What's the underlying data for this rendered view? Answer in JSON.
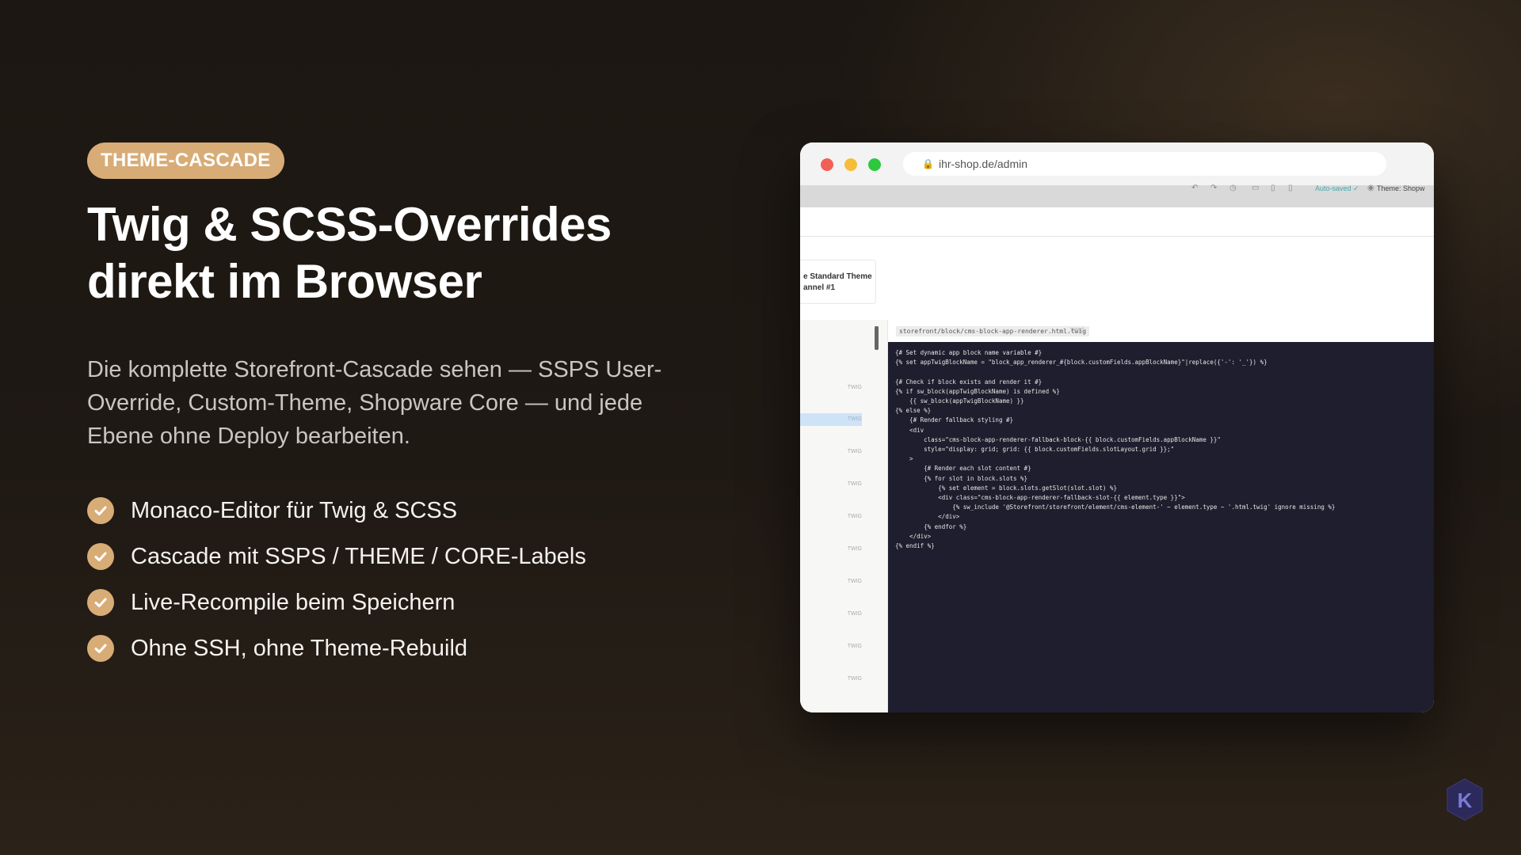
{
  "slide": {
    "badge": "THEME-CASCADE",
    "title_line1": "Twig & SCSS-Overrides",
    "title_line2": "direkt im Browser",
    "description": "Die komplette Storefront-Cascade sehen — SSPS User-Override, Custom-Theme, Shopware Core — und jede Ebene ohne Deploy bearbeiten.",
    "features": [
      "Monaco-Editor für Twig & SCSS",
      "Cascade mit SSPS / THEME / CORE-Labels",
      "Live-Recompile beim Speichern",
      "Ohne SSH, ohne Theme-Rebuild"
    ],
    "accent_color": "#d8ac76",
    "check_icon": "check-icon",
    "logo_letter": "K"
  },
  "browser": {
    "url": "ihr-shop.de/admin",
    "lock_icon": "lock-icon",
    "toolbar": {
      "autosave_label": "Auto-saved ✓",
      "theme_label": "Theme: Shopw"
    },
    "theme_card": {
      "line1": "e Standard Theme",
      "line2": "annel #1"
    },
    "sidebar_labels": [
      "TWIG",
      "TWIG",
      "TWIG",
      "TWIG",
      "TWIG",
      "TWIG",
      "TWIG",
      "TWIG",
      "TWIG",
      "TWIG"
    ],
    "editor": {
      "tab_label": "storefront/block/cms-block-app-renderer.html.twig",
      "tab_suffix": ".TWIG",
      "code_lines": [
        "{# Set dynamic app block name variable #}",
        "{% set appTwigBlockName = \"block_app_renderer_#{block.customFields.appBlockName}\"|replace({'-': '_'}) %}",
        "",
        "{# Check if block exists and render it #}",
        "{% if sw_block(appTwigBlockName) is defined %}",
        "    {{ sw_block(appTwigBlockName) }}",
        "{% else %}",
        "    {# Render fallback styling #}",
        "    <div",
        "        class=\"cms-block-app-renderer-fallback-block-{{ block.customFields.appBlockName }}\"",
        "        style=\"display: grid; grid: {{ block.customFields.slotLayout.grid }};\"",
        "    >",
        "        {# Render each slot content #}",
        "        {% for slot in block.slots %}",
        "            {% set element = block.slots.getSlot(slot.slot) %}",
        "            <div class=\"cms-block-app-renderer-fallback-slot-{{ element.type }}\">",
        "                {% sw_include '@Storefront/storefront/element/cms-element-' ~ element.type ~ '.html.twig' ignore missing %}",
        "            </div>",
        "        {% endfor %}",
        "    </div>",
        "{% endif %}"
      ]
    }
  }
}
